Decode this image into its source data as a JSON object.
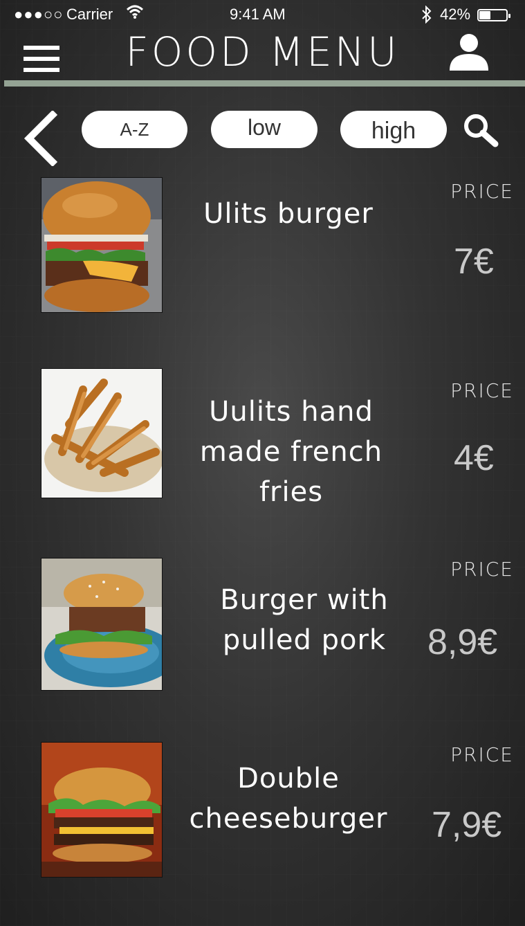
{
  "status_bar": {
    "signal": "●●●○○",
    "carrier": "Carrier",
    "time": "9:41 AM",
    "battery": "42%",
    "battery_level": 0.42
  },
  "header": {
    "title": "FOOD MENU"
  },
  "filters": {
    "az": "A-Z",
    "low": "low",
    "high": "high"
  },
  "price_label": "PRICE",
  "items": [
    {
      "name": "Ulits burger",
      "price": "7€",
      "image": "burger-photo"
    },
    {
      "name": "Uulits hand made french fries",
      "price": "4€",
      "image": "fries-photo"
    },
    {
      "name": "Burger with pulled pork",
      "price": "8,9€",
      "image": "pulled-pork-burger-photo"
    },
    {
      "name": "Double cheeseburger",
      "price": "7,9€",
      "image": "double-cheeseburger-photo"
    }
  ],
  "icons": {
    "menu": "hamburger-menu-icon",
    "user": "user-icon",
    "back": "chevron-left-icon",
    "search": "search-icon",
    "wifi": "wifi-icon",
    "bluetooth": "bluetooth-icon"
  }
}
